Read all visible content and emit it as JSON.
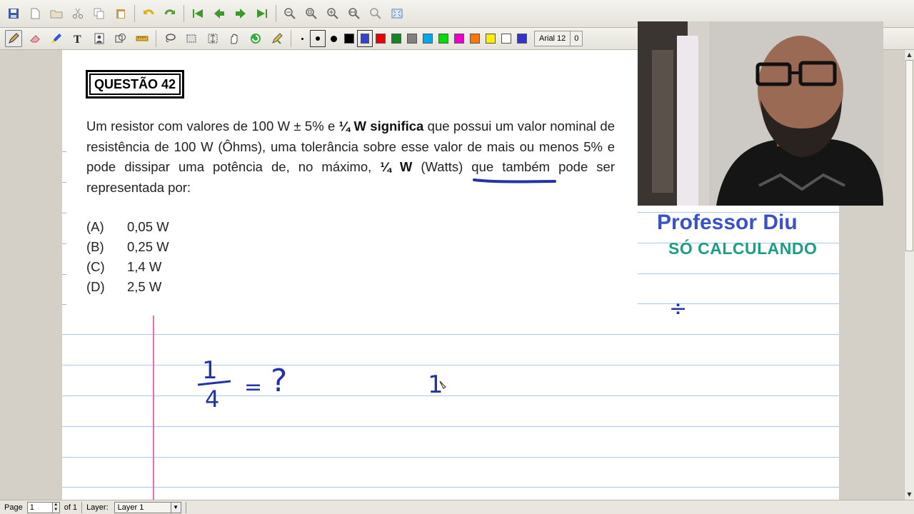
{
  "toolbar_main": {
    "icons": [
      "save-icon",
      "new-page-icon",
      "open-folder-icon",
      "cut-icon",
      "copy-icon",
      "paste-icon",
      "undo-icon",
      "redo-icon",
      "first-page-icon",
      "previous-page-icon",
      "next-page-icon",
      "last-page-icon",
      "zoom-out-icon",
      "zoom-fit-icon",
      "zoom-in-icon",
      "zoom-width-icon",
      "zoom-search-icon",
      "fullscreen-icon"
    ]
  },
  "toolbar_tools": {
    "font": "Arial 12",
    "font_size_extra": "0",
    "colors": [
      "#000000",
      "#3344cc",
      "#ee0000",
      "#118822",
      "#808080",
      "#00aaee",
      "#00dd00",
      "#ee00cc",
      "#ff7700",
      "#ffee00",
      "#ffffff",
      "#3333cc"
    ],
    "active_color": "#3344cc"
  },
  "question": {
    "title": "QUESTÃO 42",
    "text_part1": "Um resistor com valores de 100 W ± 5% e ",
    "text_bold1": "¼ W significa",
    "text_part2": " que possui um valor nominal de resistência de 100 W (Ôhms), uma tolerância sobre esse valor de mais ou menos 5% e pode dissipar uma potência de, no máximo, ",
    "text_bold2": "¼ W",
    "text_part3": " (Watts) que também pode ser representada por:",
    "options": [
      {
        "letter": "(A)",
        "value": "0,05 W"
      },
      {
        "letter": "(B)",
        "value": "0,25 W"
      },
      {
        "letter": "(C)",
        "value": "1,4 W"
      },
      {
        "letter": "(D)",
        "value": "2,5 W"
      }
    ]
  },
  "overlay": {
    "name": "Professor Diu",
    "channel": "SÓ CALCULANDO"
  },
  "handwriting": {
    "fraction_numerator": "1",
    "fraction_denominator": "4",
    "equals": "=",
    "question_mark": "?",
    "digit": "1",
    "divide_sign": "÷",
    "ink_color": "#2233aa"
  },
  "statusbar": {
    "page_label": "Page",
    "page_value": "1",
    "of_label": "of 1",
    "layer_label": "Layer:",
    "layer_value": "Layer 1"
  }
}
